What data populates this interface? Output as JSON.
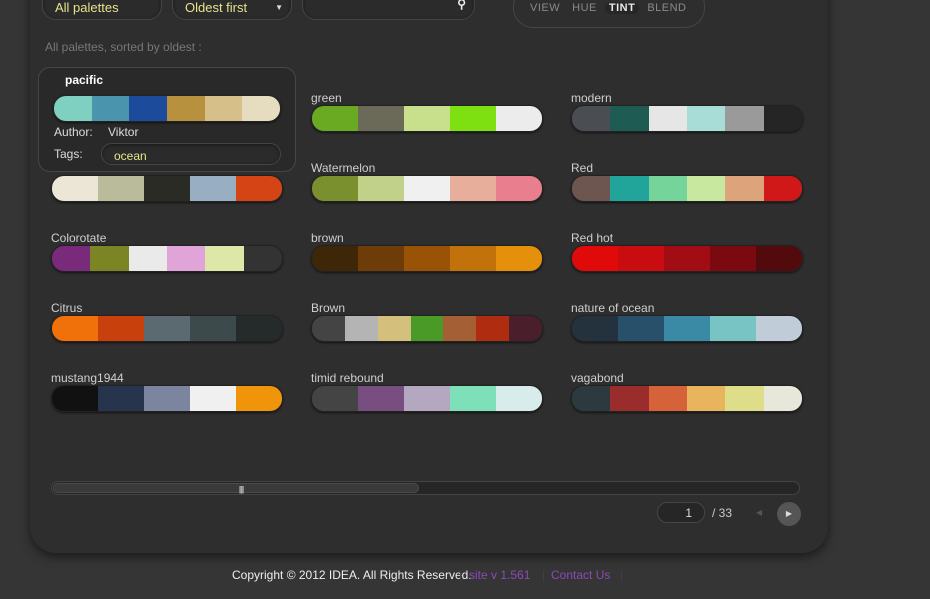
{
  "filters": {
    "palette_set": "All palettes",
    "sort": "Oldest first",
    "search_placeholder": ""
  },
  "modes": [
    {
      "label": "VIEW",
      "active": false
    },
    {
      "label": "HUE",
      "active": false
    },
    {
      "label": "TINT",
      "active": true
    },
    {
      "label": "BLEND",
      "active": false
    }
  ],
  "subtitle": "All palettes, sorted by oldest :",
  "popup": {
    "name": "pacific",
    "colors": [
      "#7fd0c0",
      "#4a95ad",
      "#1c4b9c",
      "#b8913f",
      "#d7bf8a",
      "#e6dcc0"
    ],
    "author_label": "Author:",
    "author": "Viktor",
    "tags_label": "Tags:",
    "tags": "ocean"
  },
  "palettes": [
    {
      "name": "",
      "colors": [
        "#7fd0c0",
        "#4a95ad",
        "#1c4b9c",
        "#b8913f",
        "#d7bf8a",
        "#e6dcc0"
      ]
    },
    {
      "name": "green",
      "colors": [
        "#6aaa22",
        "#6b6a58",
        "#c8e08c",
        "#7ee010",
        "#ececec"
      ]
    },
    {
      "name": "modern",
      "colors": [
        "#4a4d52",
        "#1e5b52",
        "#e6e6e6",
        "#a8dcd6",
        "#9a9a9a",
        "#252525"
      ]
    },
    {
      "name": "",
      "colors": [
        "#ece6d6",
        "#b9bb9a",
        "#2a2b25",
        "#98aec2",
        "#d54414"
      ]
    },
    {
      "name": "Watermelon",
      "colors": [
        "#7a8f2e",
        "#c1d18a",
        "#f0f0f0",
        "#e8ae9c",
        "#e97e8e"
      ]
    },
    {
      "name": "Red",
      "colors": [
        "#6e5650",
        "#21a59a",
        "#74d49a",
        "#c8e8a0",
        "#dda47c",
        "#d01818"
      ]
    },
    {
      "name": "Colorotate",
      "colors": [
        "#7a2a7a",
        "#7b8524",
        "#eaeaea",
        "#e0a4d8",
        "#dde8a8",
        "#333333"
      ]
    },
    {
      "name": "brown",
      "colors": [
        "#3e2608",
        "#6e3c08",
        "#9a5206",
        "#c2720a",
        "#e4900a"
      ]
    },
    {
      "name": "Red hot",
      "colors": [
        "#e00a0a",
        "#c80c10",
        "#a20c14",
        "#7a0a10",
        "#520a0c"
      ]
    },
    {
      "name": "Citrus",
      "colors": [
        "#f0700a",
        "#c8400c",
        "#5a6a70",
        "#3c4a4c",
        "#252a2a"
      ]
    },
    {
      "name": "Brown",
      "colors": [
        "#444444",
        "#b4b4b4",
        "#d4c07c",
        "#4a9a28",
        "#a46034",
        "#b02c10",
        "#4a1e2a"
      ]
    },
    {
      "name": "nature of ocean",
      "colors": [
        "#23323c",
        "#28506a",
        "#3a8aa6",
        "#78c4c4",
        "#c0ccd8"
      ]
    },
    {
      "name": "mustang1944",
      "colors": [
        "#111111",
        "#27344e",
        "#7c85a0",
        "#f0f0f0",
        "#f0940a"
      ]
    },
    {
      "name": "timid rebound",
      "colors": [
        "#444444",
        "#784e80",
        "#b4a8c0",
        "#7ee0b8",
        "#d8ecec"
      ]
    },
    {
      "name": "vagabond",
      "colors": [
        "#2c3a40",
        "#9a2c2c",
        "#d6623a",
        "#e8b45c",
        "#dede8a",
        "#e8e8da"
      ]
    }
  ],
  "scroll": {
    "position": 0.25
  },
  "pagination": {
    "current": "1",
    "total": "/ 33"
  },
  "footer": {
    "copyright": "Copyright © 2012 IDEA. All Rights Reserved.",
    "version": "site v 1.561",
    "contact": "Contact Us",
    "sep": "|"
  }
}
